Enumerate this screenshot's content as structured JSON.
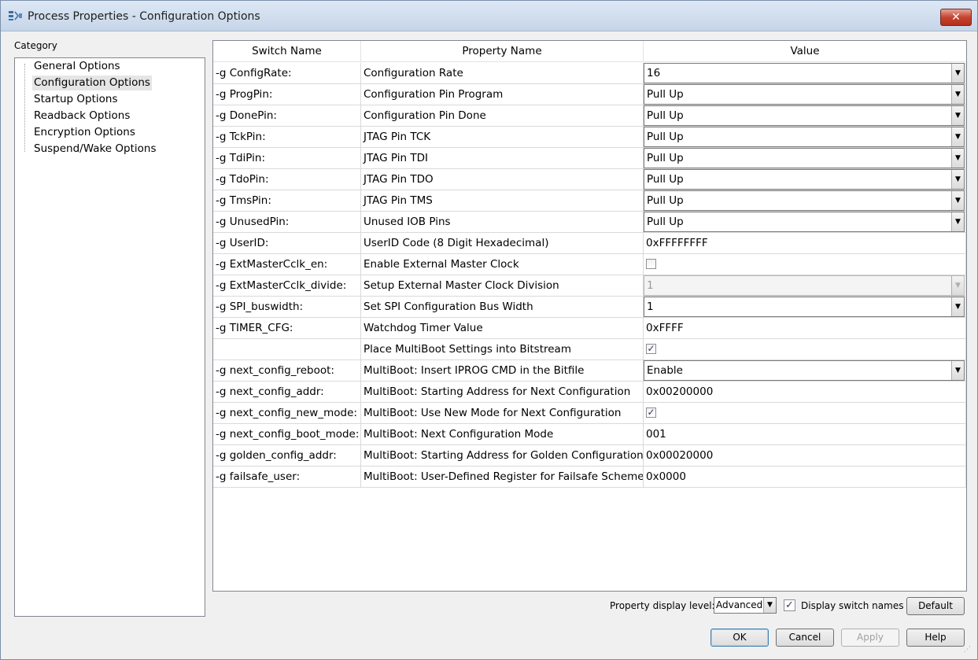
{
  "window": {
    "title": "Process Properties - Configuration Options",
    "close_label": "✕"
  },
  "category": {
    "label": "Category",
    "items": [
      {
        "label": "General Options",
        "selected": false
      },
      {
        "label": "Configuration Options",
        "selected": true
      },
      {
        "label": "Startup Options",
        "selected": false
      },
      {
        "label": "Readback Options",
        "selected": false
      },
      {
        "label": "Encryption Options",
        "selected": false
      },
      {
        "label": "Suspend/Wake Options",
        "selected": false
      }
    ]
  },
  "table": {
    "headers": [
      "Switch Name",
      "Property Name",
      "Value"
    ],
    "rows": [
      {
        "switch": "-g ConfigRate:",
        "property": "Configuration Rate",
        "type": "combo",
        "value": "16"
      },
      {
        "switch": "-g ProgPin:",
        "property": "Configuration Pin Program",
        "type": "combo",
        "value": "Pull Up"
      },
      {
        "switch": "-g DonePin:",
        "property": "Configuration Pin Done",
        "type": "combo",
        "value": "Pull Up"
      },
      {
        "switch": "-g TckPin:",
        "property": "JTAG Pin TCK",
        "type": "combo",
        "value": "Pull Up"
      },
      {
        "switch": "-g TdiPin:",
        "property": "JTAG Pin TDI",
        "type": "combo",
        "value": "Pull Up"
      },
      {
        "switch": "-g TdoPin:",
        "property": "JTAG Pin TDO",
        "type": "combo",
        "value": "Pull Up"
      },
      {
        "switch": "-g TmsPin:",
        "property": "JTAG Pin TMS",
        "type": "combo",
        "value": "Pull Up"
      },
      {
        "switch": "-g UnusedPin:",
        "property": "Unused IOB Pins",
        "type": "combo",
        "value": "Pull Up"
      },
      {
        "switch": "-g UserID:",
        "property": "UserID Code (8 Digit Hexadecimal)",
        "type": "text",
        "value": "0xFFFFFFFF"
      },
      {
        "switch": "-g ExtMasterCclk_en:",
        "property": "Enable External Master Clock",
        "type": "checkbox",
        "checked": false
      },
      {
        "switch": "-g ExtMasterCclk_divide:",
        "property": "Setup External Master Clock Division",
        "type": "combo-disabled",
        "value": "1"
      },
      {
        "switch": "-g SPI_buswidth:",
        "property": "Set SPI Configuration Bus Width",
        "type": "combo",
        "value": "1"
      },
      {
        "switch": "-g TIMER_CFG:",
        "property": "Watchdog Timer Value",
        "type": "text",
        "value": "0xFFFF"
      },
      {
        "switch": "",
        "property": "Place MultiBoot Settings into Bitstream",
        "type": "checkbox",
        "checked": true
      },
      {
        "switch": "-g next_config_reboot:",
        "property": "MultiBoot: Insert IPROG CMD in the Bitfile",
        "type": "combo",
        "value": "Enable"
      },
      {
        "switch": "-g next_config_addr:",
        "property": "MultiBoot: Starting Address for Next Configuration",
        "type": "text",
        "value": "0x00200000"
      },
      {
        "switch": "-g next_config_new_mode:",
        "property": "MultiBoot: Use New Mode for Next Configuration",
        "type": "checkbox",
        "checked": true
      },
      {
        "switch": "-g next_config_boot_mode:",
        "property": "MultiBoot: Next Configuration Mode",
        "type": "text",
        "value": "001"
      },
      {
        "switch": "-g golden_config_addr:",
        "property": "MultiBoot: Starting Address for Golden Configuration",
        "type": "text",
        "value": "0x00020000"
      },
      {
        "switch": "-g failsafe_user:",
        "property": "MultiBoot: User-Defined Register for Failsafe Scheme",
        "type": "text",
        "value": "0x0000"
      }
    ]
  },
  "footer": {
    "display_level_label": "Property display level:",
    "display_level_value": "Advanced",
    "display_switch_names_label": "Display switch names",
    "display_switch_names_checked": true,
    "default_label": "Default",
    "ok_label": "OK",
    "cancel_label": "Cancel",
    "apply_label": "Apply",
    "help_label": "Help"
  },
  "icons": {
    "check": "✓",
    "dropdown": "▼"
  }
}
